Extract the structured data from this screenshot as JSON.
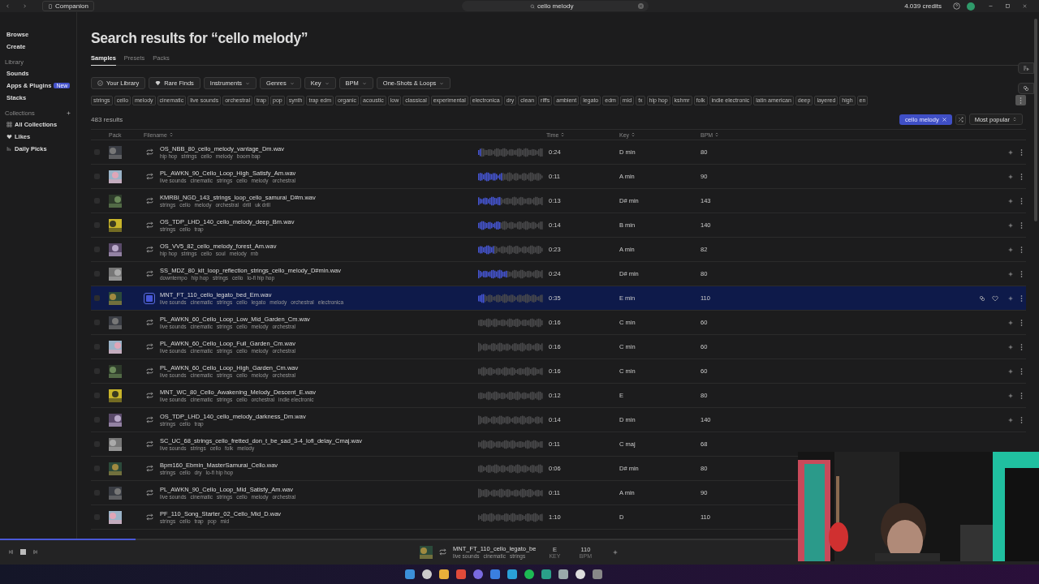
{
  "titlebar": {
    "companion": "Companion",
    "search": {
      "value": "cello melody"
    },
    "credits": "4.039 credits"
  },
  "sidebar": {
    "main": [
      {
        "label": "Browse"
      },
      {
        "label": "Create"
      }
    ],
    "library": {
      "title": "Library",
      "items": [
        {
          "label": "Sounds"
        },
        {
          "label": "Apps & Plugins",
          "badge": "New"
        },
        {
          "label": "Stacks"
        }
      ]
    },
    "collections": {
      "title": "Collections",
      "items": [
        {
          "label": "All Collections",
          "kind": "grid"
        },
        {
          "label": "Likes",
          "kind": "heart"
        },
        {
          "label": "Daily Picks",
          "kind": "picks"
        }
      ]
    }
  },
  "heading": "Search results for “cello melody”",
  "tabs": [
    {
      "label": "Samples",
      "selected": true
    },
    {
      "label": "Presets",
      "selected": false
    },
    {
      "label": "Packs",
      "selected": false
    }
  ],
  "filters": [
    {
      "label": "Your Library",
      "kind": "check"
    },
    {
      "label": "Rare Finds",
      "kind": "gem"
    },
    {
      "label": "Instruments",
      "kind": "dropdown"
    },
    {
      "label": "Genres",
      "kind": "dropdown"
    },
    {
      "label": "Key",
      "kind": "dropdown"
    },
    {
      "label": "BPM",
      "kind": "dropdown"
    },
    {
      "label": "One-Shots & Loops",
      "kind": "dropdown"
    }
  ],
  "tags": [
    "strings",
    "cello",
    "melody",
    "cinematic",
    "live sounds",
    "orchestral",
    "trap",
    "pop",
    "synth",
    "trap edm",
    "organic",
    "acoustic",
    "low",
    "classical",
    "experimental",
    "electronica",
    "dry",
    "clean",
    "riffs",
    "ambient",
    "legato",
    "edm",
    "mid",
    "fx",
    "hip hop",
    "kshmr",
    "folk",
    "indie electronic",
    "latin american",
    "deep",
    "layered",
    "high",
    "en"
  ],
  "results_count": "483 results",
  "query_chip": "cello melody",
  "sort": "Most popular",
  "columns": [
    {
      "label": "Pack",
      "sortable": false
    },
    {
      "label": "Filename",
      "sortable": true
    },
    {
      "label": "Time",
      "sortable": true
    },
    {
      "label": "Key",
      "sortable": true
    },
    {
      "label": "BPM",
      "sortable": true
    }
  ],
  "rows": [
    {
      "filename": "OS_NBB_80_cello_melody_vantage_Dm.wav",
      "tags": [
        "hip hop",
        "strings",
        "cello",
        "melody",
        "boom bap"
      ],
      "time": "0:24",
      "key": "D min",
      "bpm": "80",
      "level": 0.05,
      "selected": false,
      "actions": true
    },
    {
      "filename": "PL_AWKN_90_Cello_Loop_High_Satisfy_Am.wav",
      "tags": [
        "live sounds",
        "cinematic",
        "strings",
        "cello",
        "melody",
        "orchestral"
      ],
      "time": "0:11",
      "key": "A min",
      "bpm": "90",
      "level": 0.36,
      "selected": false,
      "actions": true
    },
    {
      "filename": "KMRBI_NGD_143_strings_loop_cello_samurai_D#m.wav",
      "tags": [
        "strings",
        "cello",
        "melody",
        "orchestral",
        "drill",
        "uk drill"
      ],
      "time": "0:13",
      "key": "D# min",
      "bpm": "143",
      "level": 0.35,
      "selected": false,
      "actions": true
    },
    {
      "filename": "OS_TDP_LHD_140_cello_melody_deep_Bm.wav",
      "tags": [
        "strings",
        "cello",
        "trap"
      ],
      "time": "0:14",
      "key": "B min",
      "bpm": "140",
      "level": 0.35,
      "selected": false,
      "actions": true
    },
    {
      "filename": "OS_VV5_82_cello_melody_forest_Am.wav",
      "tags": [
        "hip hop",
        "strings",
        "cello",
        "soul",
        "melody",
        "rnb"
      ],
      "time": "0:23",
      "key": "A min",
      "bpm": "82",
      "level": 0.25,
      "selected": false,
      "actions": true
    },
    {
      "filename": "SS_MDZ_80_kit_loop_reflection_strings_cello_melody_D#min.wav",
      "tags": [
        "downtempo",
        "hip hop",
        "strings",
        "cello",
        "lo-fi hip hop"
      ],
      "time": "0:24",
      "key": "D# min",
      "bpm": "80",
      "level": 0.45,
      "selected": false,
      "actions": true
    },
    {
      "filename": "MNT_FT_110_cello_legato_bed_Em.wav",
      "tags": [
        "live sounds",
        "cinematic",
        "strings",
        "cello",
        "legato",
        "melody",
        "orchestral",
        "electronica"
      ],
      "time": "0:35",
      "key": "E min",
      "bpm": "110",
      "level": 0.1,
      "selected": true,
      "actions": true
    },
    {
      "filename": "PL_AWKN_60_Cello_Loop_Low_Mid_Garden_Cm.wav",
      "tags": [
        "live sounds",
        "cinematic",
        "strings",
        "cello",
        "melody",
        "orchestral"
      ],
      "time": "0:16",
      "key": "C min",
      "bpm": "60",
      "level": 0,
      "selected": false,
      "actions": true
    },
    {
      "filename": "PL_AWKN_60_Cello_Loop_Full_Garden_Cm.wav",
      "tags": [
        "live sounds",
        "cinematic",
        "strings",
        "cello",
        "melody",
        "orchestral"
      ],
      "time": "0:16",
      "key": "C min",
      "bpm": "60",
      "level": 0,
      "selected": false,
      "actions": true
    },
    {
      "filename": "PL_AWKN_60_Cello_Loop_High_Garden_Cm.wav",
      "tags": [
        "live sounds",
        "cinematic",
        "strings",
        "cello",
        "melody",
        "orchestral"
      ],
      "time": "0:16",
      "key": "C min",
      "bpm": "60",
      "level": 0,
      "selected": false,
      "actions": true
    },
    {
      "filename": "MNT_WC_80_Cello_Awakening_Melody_Descent_E.wav",
      "tags": [
        "live sounds",
        "cinematic",
        "strings",
        "cello",
        "orchestral",
        "indie electronic"
      ],
      "time": "0:12",
      "key": "E",
      "bpm": "80",
      "level": 0,
      "selected": false,
      "actions": true
    },
    {
      "filename": "OS_TDP_LHD_140_cello_melody_darkness_Dm.wav",
      "tags": [
        "strings",
        "cello",
        "trap"
      ],
      "time": "0:14",
      "key": "D min",
      "bpm": "140",
      "level": 0,
      "selected": false,
      "actions": true
    },
    {
      "filename": "SC_UC_68_strings_cello_fretted_don_t_be_sad_3-4_lofi_delay_Cmaj.wav",
      "tags": [
        "live sounds",
        "strings",
        "cello",
        "folk",
        "melody"
      ],
      "time": "0:11",
      "key": "C maj",
      "bpm": "68",
      "level": 0,
      "selected": false,
      "actions": false
    },
    {
      "filename": "Bpm160_Ebmin_MasterSamurai_Cello.wav",
      "tags": [
        "strings",
        "cello",
        "dry",
        "lo-fi hip hop"
      ],
      "time": "0:06",
      "key": "D# min",
      "bpm": "80",
      "level": 0,
      "selected": false,
      "actions": false
    },
    {
      "filename": "PL_AWKN_90_Cello_Loop_Mid_Satisfy_Am.wav",
      "tags": [
        "live sounds",
        "cinematic",
        "strings",
        "cello",
        "melody",
        "orchestral"
      ],
      "time": "0:11",
      "key": "A min",
      "bpm": "90",
      "level": 0,
      "selected": false,
      "actions": false
    },
    {
      "filename": "PF_110_Song_Starter_02_Cello_Mid_D.wav",
      "tags": [
        "strings",
        "cello",
        "trap",
        "pop",
        "mid"
      ],
      "time": "1:10",
      "key": "D",
      "bpm": "110",
      "level": 0,
      "selected": false,
      "actions": false
    }
  ],
  "player": {
    "level": 0.17,
    "title": "MNT_FT_110_cello_legato_be",
    "tags": [
      "live sounds",
      "cinematic",
      "strings"
    ],
    "key": "E",
    "key_label": "KEY",
    "bpm": "110",
    "bpm_label": "BPM"
  }
}
